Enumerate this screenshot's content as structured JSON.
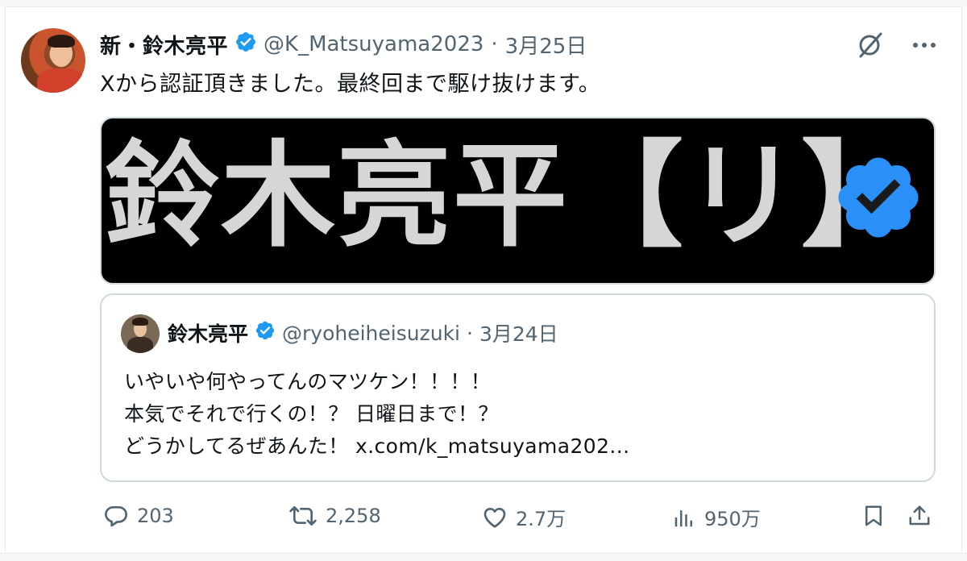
{
  "tweet": {
    "display_name": "新・鈴木亮平",
    "handle": "@K_Matsuyama2023",
    "separator": "·",
    "date": "3月25日",
    "text": "Xから認証頂きました。最終回まで駆け抜けます。"
  },
  "media": {
    "text": "鈴木亮平【リ】"
  },
  "quote": {
    "display_name": "鈴木亮平",
    "handle": "@ryoheiheisuzuki",
    "separator": "·",
    "date": "3月24日",
    "lines": [
      "いやいや何やってんのマツケン！！！！",
      "本気でそれで行くの！？ 日曜日まで！？",
      "どうかしてるぜあんた！ x.com/k_matsuyama202..."
    ]
  },
  "actions": {
    "replies": "203",
    "retweets": "2,258",
    "likes": "2.7万",
    "views": "950万"
  },
  "icons": {
    "verified": "verified-badge-icon",
    "grok": "grok-icon",
    "more": "more-icon",
    "reply": "reply-icon",
    "retweet": "retweet-icon",
    "like": "like-icon",
    "views": "views-icon",
    "bookmark": "bookmark-icon",
    "share": "share-icon"
  },
  "colors": {
    "verified": "#1d9bf0",
    "secondary_text": "#536471",
    "border": "#cfd9de"
  }
}
